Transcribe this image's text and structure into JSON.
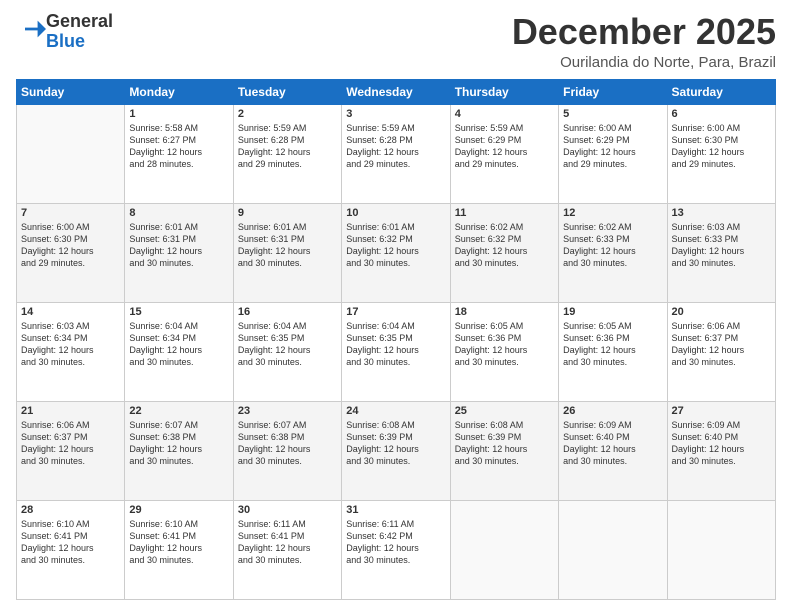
{
  "header": {
    "logo": {
      "line1": "General",
      "line2": "Blue"
    },
    "month": "December 2025",
    "location": "Ourilandia do Norte, Para, Brazil"
  },
  "weekdays": [
    "Sunday",
    "Monday",
    "Tuesday",
    "Wednesday",
    "Thursday",
    "Friday",
    "Saturday"
  ],
  "weeks": [
    [
      {
        "day": "",
        "info": ""
      },
      {
        "day": "1",
        "info": "Sunrise: 5:58 AM\nSunset: 6:27 PM\nDaylight: 12 hours\nand 28 minutes."
      },
      {
        "day": "2",
        "info": "Sunrise: 5:59 AM\nSunset: 6:28 PM\nDaylight: 12 hours\nand 29 minutes."
      },
      {
        "day": "3",
        "info": "Sunrise: 5:59 AM\nSunset: 6:28 PM\nDaylight: 12 hours\nand 29 minutes."
      },
      {
        "day": "4",
        "info": "Sunrise: 5:59 AM\nSunset: 6:29 PM\nDaylight: 12 hours\nand 29 minutes."
      },
      {
        "day": "5",
        "info": "Sunrise: 6:00 AM\nSunset: 6:29 PM\nDaylight: 12 hours\nand 29 minutes."
      },
      {
        "day": "6",
        "info": "Sunrise: 6:00 AM\nSunset: 6:30 PM\nDaylight: 12 hours\nand 29 minutes."
      }
    ],
    [
      {
        "day": "7",
        "info": "Sunrise: 6:00 AM\nSunset: 6:30 PM\nDaylight: 12 hours\nand 29 minutes."
      },
      {
        "day": "8",
        "info": "Sunrise: 6:01 AM\nSunset: 6:31 PM\nDaylight: 12 hours\nand 30 minutes."
      },
      {
        "day": "9",
        "info": "Sunrise: 6:01 AM\nSunset: 6:31 PM\nDaylight: 12 hours\nand 30 minutes."
      },
      {
        "day": "10",
        "info": "Sunrise: 6:01 AM\nSunset: 6:32 PM\nDaylight: 12 hours\nand 30 minutes."
      },
      {
        "day": "11",
        "info": "Sunrise: 6:02 AM\nSunset: 6:32 PM\nDaylight: 12 hours\nand 30 minutes."
      },
      {
        "day": "12",
        "info": "Sunrise: 6:02 AM\nSunset: 6:33 PM\nDaylight: 12 hours\nand 30 minutes."
      },
      {
        "day": "13",
        "info": "Sunrise: 6:03 AM\nSunset: 6:33 PM\nDaylight: 12 hours\nand 30 minutes."
      }
    ],
    [
      {
        "day": "14",
        "info": "Sunrise: 6:03 AM\nSunset: 6:34 PM\nDaylight: 12 hours\nand 30 minutes."
      },
      {
        "day": "15",
        "info": "Sunrise: 6:04 AM\nSunset: 6:34 PM\nDaylight: 12 hours\nand 30 minutes."
      },
      {
        "day": "16",
        "info": "Sunrise: 6:04 AM\nSunset: 6:35 PM\nDaylight: 12 hours\nand 30 minutes."
      },
      {
        "day": "17",
        "info": "Sunrise: 6:04 AM\nSunset: 6:35 PM\nDaylight: 12 hours\nand 30 minutes."
      },
      {
        "day": "18",
        "info": "Sunrise: 6:05 AM\nSunset: 6:36 PM\nDaylight: 12 hours\nand 30 minutes."
      },
      {
        "day": "19",
        "info": "Sunrise: 6:05 AM\nSunset: 6:36 PM\nDaylight: 12 hours\nand 30 minutes."
      },
      {
        "day": "20",
        "info": "Sunrise: 6:06 AM\nSunset: 6:37 PM\nDaylight: 12 hours\nand 30 minutes."
      }
    ],
    [
      {
        "day": "21",
        "info": "Sunrise: 6:06 AM\nSunset: 6:37 PM\nDaylight: 12 hours\nand 30 minutes."
      },
      {
        "day": "22",
        "info": "Sunrise: 6:07 AM\nSunset: 6:38 PM\nDaylight: 12 hours\nand 30 minutes."
      },
      {
        "day": "23",
        "info": "Sunrise: 6:07 AM\nSunset: 6:38 PM\nDaylight: 12 hours\nand 30 minutes."
      },
      {
        "day": "24",
        "info": "Sunrise: 6:08 AM\nSunset: 6:39 PM\nDaylight: 12 hours\nand 30 minutes."
      },
      {
        "day": "25",
        "info": "Sunrise: 6:08 AM\nSunset: 6:39 PM\nDaylight: 12 hours\nand 30 minutes."
      },
      {
        "day": "26",
        "info": "Sunrise: 6:09 AM\nSunset: 6:40 PM\nDaylight: 12 hours\nand 30 minutes."
      },
      {
        "day": "27",
        "info": "Sunrise: 6:09 AM\nSunset: 6:40 PM\nDaylight: 12 hours\nand 30 minutes."
      }
    ],
    [
      {
        "day": "28",
        "info": "Sunrise: 6:10 AM\nSunset: 6:41 PM\nDaylight: 12 hours\nand 30 minutes."
      },
      {
        "day": "29",
        "info": "Sunrise: 6:10 AM\nSunset: 6:41 PM\nDaylight: 12 hours\nand 30 minutes."
      },
      {
        "day": "30",
        "info": "Sunrise: 6:11 AM\nSunset: 6:41 PM\nDaylight: 12 hours\nand 30 minutes."
      },
      {
        "day": "31",
        "info": "Sunrise: 6:11 AM\nSunset: 6:42 PM\nDaylight: 12 hours\nand 30 minutes."
      },
      {
        "day": "",
        "info": ""
      },
      {
        "day": "",
        "info": ""
      },
      {
        "day": "",
        "info": ""
      }
    ]
  ]
}
